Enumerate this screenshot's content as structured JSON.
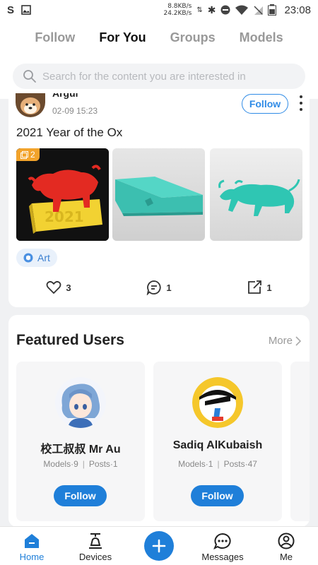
{
  "status_bar": {
    "net_up": "8.8KB/s",
    "net_down": "24.2KB/s",
    "time": "23:08"
  },
  "tabs": [
    {
      "label": "Follow",
      "active": false
    },
    {
      "label": "For You",
      "active": true
    },
    {
      "label": "Groups",
      "active": false
    },
    {
      "label": "Models",
      "active": false
    }
  ],
  "search": {
    "placeholder": "Search for the content you are interested in"
  },
  "post": {
    "username": "Argul",
    "time": "02-09 15:23",
    "follow_label": "Follow",
    "title": "2021 Year of the Ox",
    "image_count": "2",
    "tag": "Art",
    "likes": "3",
    "comments": "1",
    "shares": "1"
  },
  "featured": {
    "title": "Featured Users",
    "more_label": "More",
    "users": [
      {
        "name": "校工叔叔 Mr Au",
        "models": "Models·9",
        "posts": "Posts·1",
        "follow_label": "Follow"
      },
      {
        "name": "Sadiq AlKubaish",
        "models": "Models·1",
        "posts": "Posts·47",
        "follow_label": "Follow"
      }
    ]
  },
  "bottom_nav": {
    "home": "Home",
    "devices": "Devices",
    "messages": "Messages",
    "me": "Me"
  },
  "colors": {
    "accent": "#1f7fd9",
    "badge": "#f2a32b"
  }
}
